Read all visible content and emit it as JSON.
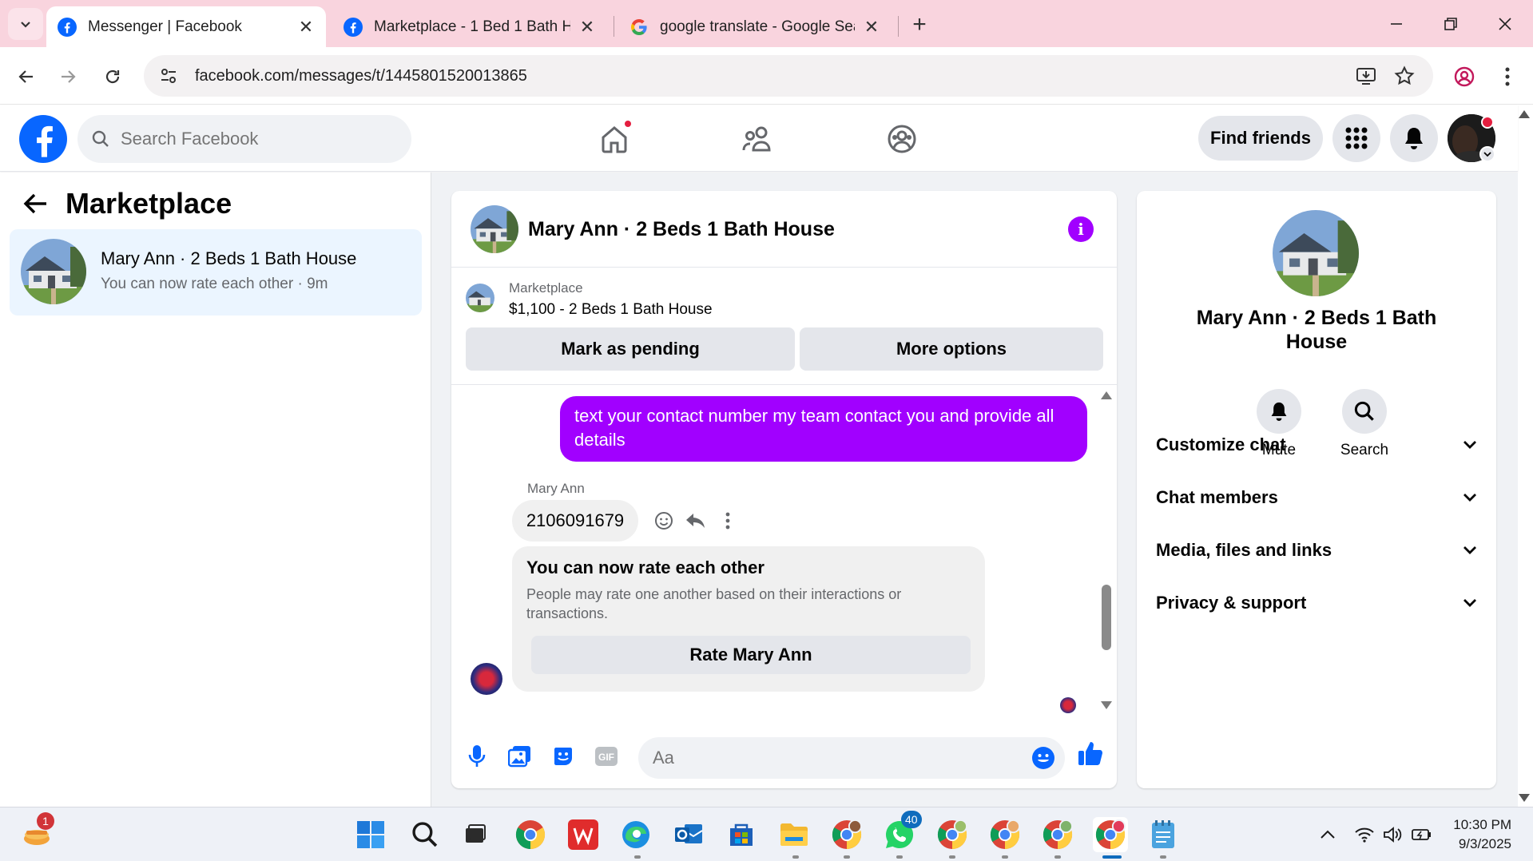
{
  "browser": {
    "tabs": [
      {
        "title": "Messenger | Facebook",
        "active": true
      },
      {
        "title": "Marketplace - 1 Bed 1 Bath Hou",
        "active": false
      },
      {
        "title": "google translate - Google Searc",
        "active": false
      }
    ],
    "url": "facebook.com/messages/t/1445801520013865"
  },
  "facebook": {
    "search_placeholder": "Search Facebook",
    "find_friends_label": "Find friends"
  },
  "left_panel": {
    "title": "Marketplace",
    "conversation": {
      "name": "Mary Ann · 2 Beds 1 Bath House",
      "preview": "You can now rate each other · 9m"
    }
  },
  "chat": {
    "header_name": "Mary Ann · 2 Beds 1 Bath House",
    "marketplace_label": "Marketplace",
    "listing": "$1,100 - 2 Beds 1 Bath House",
    "mark_pending_label": "Mark as pending",
    "more_options_label": "More options",
    "outgoing_message": "text your contact number my team contact you and provide all details",
    "sender_name": "Mary Ann",
    "incoming_message": "2106091679",
    "rate_card": {
      "title": "You can now rate each other",
      "description": "People may rate one another based on their interactions or transactions.",
      "button_label": "Rate Mary Ann"
    },
    "composer_placeholder": "Aa"
  },
  "info_panel": {
    "name": "Mary Ann · 2 Beds 1 Bath House",
    "actions": [
      {
        "label": "Mute"
      },
      {
        "label": "Search"
      }
    ],
    "sections": [
      {
        "label": "Customize chat"
      },
      {
        "label": "Chat members"
      },
      {
        "label": "Media, files and links"
      },
      {
        "label": "Privacy & support"
      }
    ]
  },
  "taskbar": {
    "widget_badge": "1",
    "whatsapp_badge": "40",
    "time": "10:30 PM",
    "date": "9/3/2025"
  },
  "colors": {
    "facebook_blue": "#0866ff",
    "messenger_purple": "#a100ff",
    "notification_red": "#e41e3f",
    "tabstrip_pink": "#f9d4de"
  }
}
